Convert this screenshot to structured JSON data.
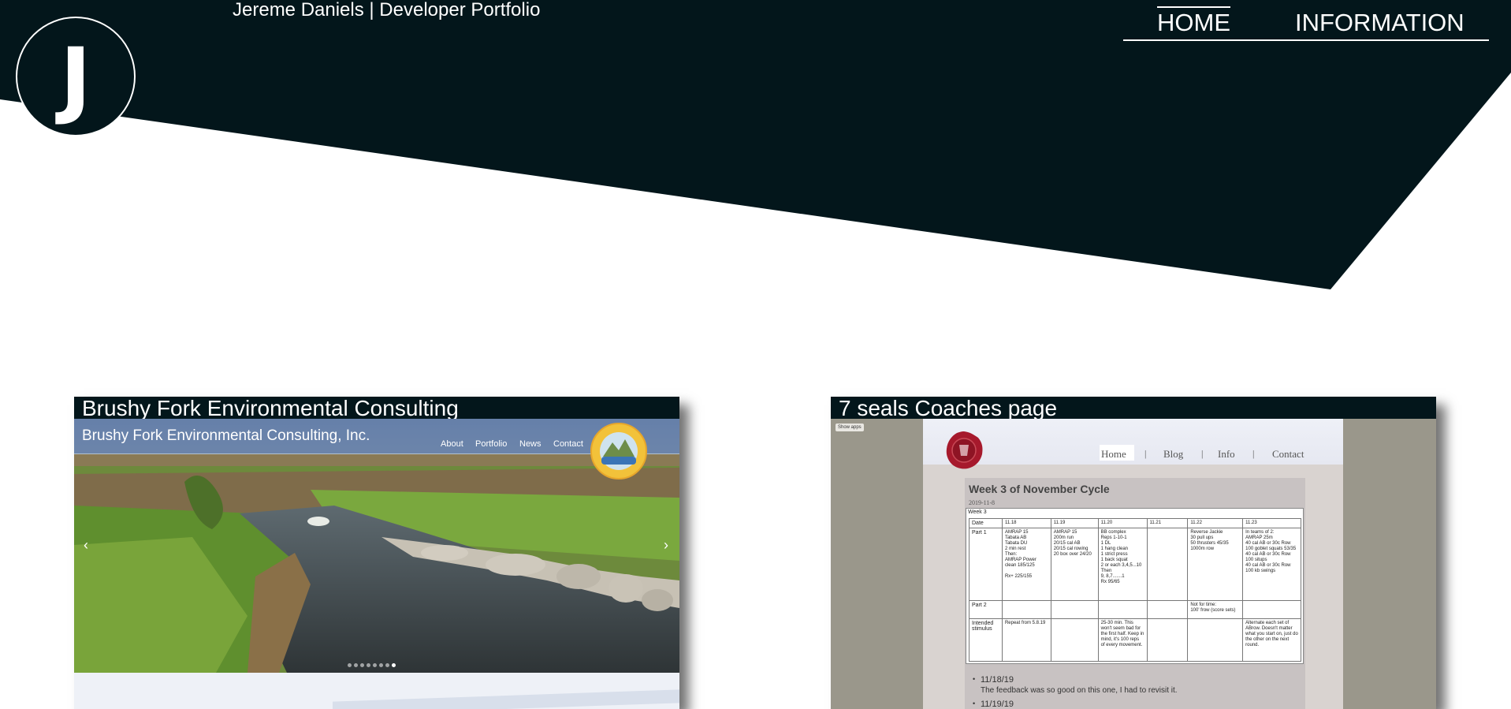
{
  "header": {
    "logo_letter": "J",
    "site_title": "Jereme Daniels | Developer Portfolio",
    "nav": [
      {
        "label": "HOME",
        "active": true
      },
      {
        "label": "INFORMATION",
        "active": false
      }
    ]
  },
  "colors": {
    "dark": "#03161b",
    "white": "#ffffff"
  },
  "projects": [
    {
      "title": "Brushy Fork Environmental Consulting",
      "screenshot": {
        "brand": "Brushy Fork Environmental Consulting, Inc.",
        "menu": [
          "About",
          "Portfolio",
          "News",
          "Contact"
        ],
        "badge_text": "Brushy Fork Environmental Consulting, Inc.",
        "prev_arrow": "‹",
        "next_arrow": "›",
        "slide_count": 8,
        "active_slide": 8
      }
    },
    {
      "title": "7 seals Coaches page",
      "screenshot": {
        "show_apps": "Show apps",
        "nav": [
          "Home",
          "Blog",
          "Info",
          "Contact"
        ],
        "separator": "|",
        "heading": "Week 3 of November Cycle",
        "date": "2019-11-8",
        "week": "Week 3",
        "table": {
          "headers": [
            "Date",
            "11.18",
            "11.19",
            "11.20",
            "11.21",
            "11.22",
            "11.23"
          ],
          "rows": [
            {
              "label": "Part 1",
              "cells": [
                "AMRAP 15\nTabata AB\nTabata DU\n2 min rest\nThen:\n  AMRAP Power\nclean 185/125\n\nRx+ 225/155",
                "AMRAP 15\n200m run\n20/15 cal AB\n20/15 cal rowing\n20 box over 24/20",
                "BB complex\nReps 1-10-1\n1 DL\n1 hang clean\n1 strict press\n1 back squat\n2 or each 3,4,5...10\nThen\n9, 8,7.......1\nRx 95/65",
                "",
                "Reverse Jackie\n30 pull ups\n50 thrusters 45/35\n1000m row",
                "In teams of 2:\nAMRAP 25m\n40 cal AB or 30c  Row\n100 goblet squats 53/35\n40 cal AB or 30c  Row\n100 situps\n40 cal AB or 30c  Row\n100 kb swings"
              ]
            },
            {
              "label": "Part 2",
              "cells": [
                "",
                "",
                "",
                "",
                "Not for time:\n100' frow (score sets)",
                ""
              ]
            },
            {
              "label": "Intended stimulus",
              "cells": [
                "Repeat from 5.8.19",
                "",
                "25-30 min. This won't seem bad for the first half. Keep in mind, it's 100 reps of every movement.",
                "",
                "",
                "Alternate each set of ABrow. Doesn't matter what you start on, just do the other on the next round."
              ]
            }
          ]
        },
        "posts": [
          {
            "date": "11/18/19",
            "text": "The feedback was so good on this one, I had to revisit it."
          },
          {
            "date": "11/19/19",
            "text": ""
          }
        ]
      }
    }
  ]
}
